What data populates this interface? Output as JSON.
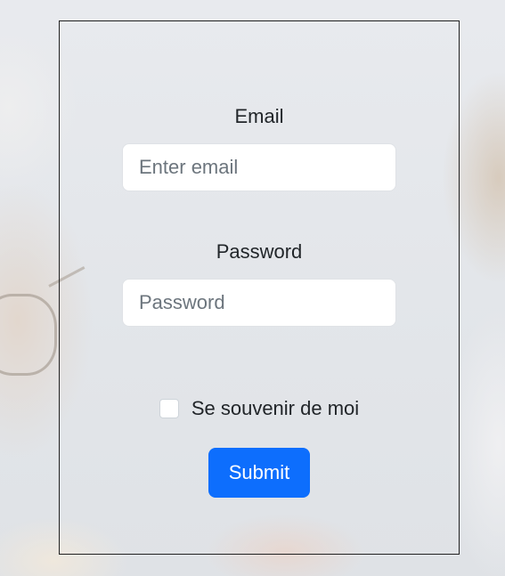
{
  "form": {
    "email_label": "Email",
    "email_placeholder": "Enter email",
    "email_value": "",
    "password_label": "Password",
    "password_placeholder": "Password",
    "password_value": "",
    "remember_label": "Se souvenir de moi",
    "remember_checked": false,
    "submit_label": "Submit"
  },
  "colors": {
    "primary": "#0d6efd",
    "text": "#212529",
    "placeholder": "#6c757d"
  }
}
